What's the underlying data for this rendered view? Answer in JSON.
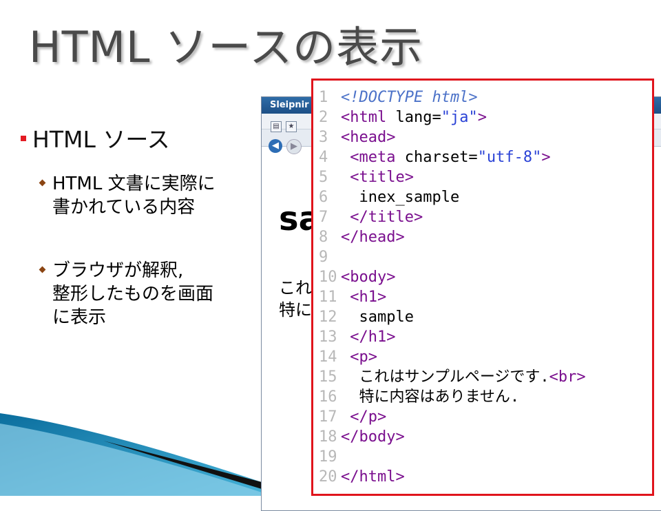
{
  "slide": {
    "title": "HTML ソースの表示",
    "bullet1": "HTML ソース",
    "sub1_line1": "HTML 文書に実際に",
    "sub1_line2": "書かれている内容",
    "sub2_line1": "ブラウザが解釈,",
    "sub2_line2": "整形したものを画面",
    "sub2_line3": "に表示"
  },
  "browser": {
    "title": "Sleipnir",
    "heading_partial": "sa",
    "para_line1_partial": "これ",
    "para_line2_partial": "特に"
  },
  "source": {
    "lines": [
      {
        "n": "1",
        "t1": "<!DOCTYPE html>"
      },
      {
        "n": "2",
        "t1": "<html ",
        "t2": "lang=",
        "t3": "\"ja\"",
        "t4": ">"
      },
      {
        "n": "3",
        "t1": "<head>"
      },
      {
        "n": "4",
        "t1": " <meta ",
        "t2": "charset=",
        "t3": "\"utf-8\"",
        "t4": ">"
      },
      {
        "n": "5",
        "t1": " <title>"
      },
      {
        "n": "6",
        "t1": "  inex_sample"
      },
      {
        "n": "7",
        "t1": " </title>"
      },
      {
        "n": "8",
        "t1": "</head>"
      },
      {
        "n": "9",
        "t1": ""
      },
      {
        "n": "10",
        "t1": "<body>"
      },
      {
        "n": "11",
        "t1": " <h1>"
      },
      {
        "n": "12",
        "t1": "  sample"
      },
      {
        "n": "13",
        "t1": " </h1>"
      },
      {
        "n": "14",
        "t1": " <p>"
      },
      {
        "n": "15",
        "t1": "  これはサンプルページです.",
        "t2": "<br>"
      },
      {
        "n": "16",
        "t1": "  特に内容はありません."
      },
      {
        "n": "17",
        "t1": " </p>"
      },
      {
        "n": "18",
        "t1": "</body>"
      },
      {
        "n": "19",
        "t1": ""
      },
      {
        "n": "20",
        "t1": "</html>"
      }
    ]
  },
  "colors": {
    "highlight_border": "#e0141c",
    "tag": "#7a0f8e",
    "string": "#2a42d6",
    "doctype": "#4c72c8"
  }
}
